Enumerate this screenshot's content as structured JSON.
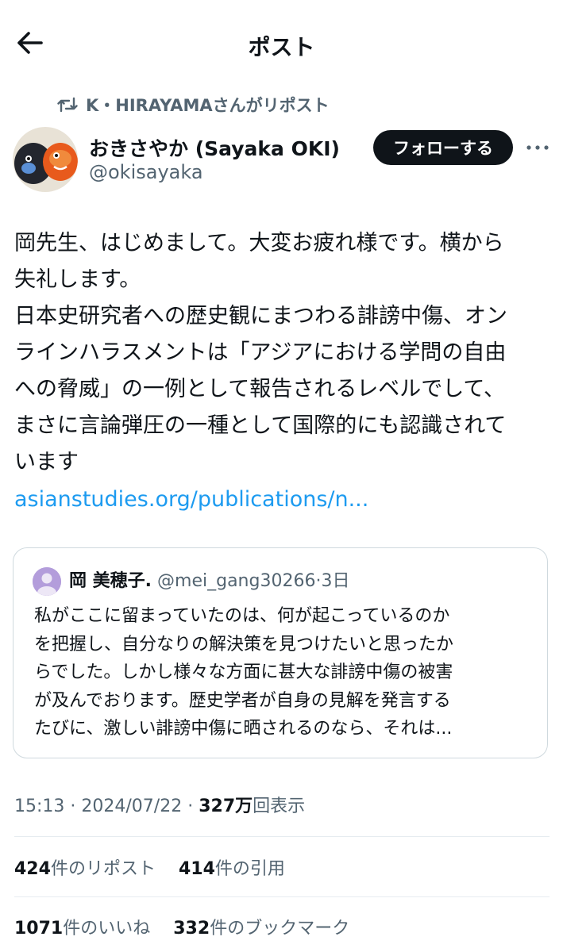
{
  "header": {
    "title": "ポスト"
  },
  "repost": {
    "text": "K・HIRAYAMAさんがリポスト"
  },
  "author": {
    "display_name": "おきさやか (Sayaka OKI)",
    "handle": "@okisayaka"
  },
  "follow": {
    "label": "フォローする"
  },
  "tweet": {
    "lines": [
      "岡先生、はじめまして。大変お疲れ様です。横から",
      "失礼します。",
      "日本史研究者への歴史観にまつわる誹謗中傷、オン",
      "ラインハラスメントは「アジアにおける学問の自由",
      "への脅威」の一例として報告されるレベルでして、",
      "まさに言論弾圧の一種として国際的にも認識されて",
      "います"
    ],
    "link": "asianstudies.org/publications/n..."
  },
  "quote": {
    "name": "岡 美穂子.",
    "handle": "@mei_gang30266",
    "dot": "·",
    "time": "3日",
    "lines": [
      "私がここに留まっていたのは、何が起こっているのか",
      "を把握し、自分なりの解決策を見つけたいと思ったか",
      "らでした。しかし様々な方面に甚大な誹謗中傷の被害",
      "が及んでおります。歴史学者が自身の見解を発言する",
      "たびに、激しい誹謗中傷に晒されるのなら、それは..."
    ]
  },
  "meta": {
    "time": "15:13",
    "sep1": "·",
    "date": "2024/07/22",
    "sep2": "·",
    "views_num": "327万",
    "views_label": "回表示"
  },
  "stats": {
    "reposts_num": "424",
    "reposts_label": "件のリポスト",
    "quotes_num": "414",
    "quotes_label": "件の引用",
    "likes_num": "1071",
    "likes_label": "件のいいね",
    "bookmarks_num": "332",
    "bookmarks_label": "件のブックマーク"
  },
  "colors": {
    "link": "#1d9bf0",
    "text": "#0f1419",
    "muted": "#536471",
    "follow_bg": "#0f1419",
    "border": "#cfd9de"
  },
  "icons": {
    "back": "arrow-left-icon",
    "repost": "repost-icon",
    "more": "more-horizontal-icon",
    "quote_avatar": "default-user-icon"
  }
}
